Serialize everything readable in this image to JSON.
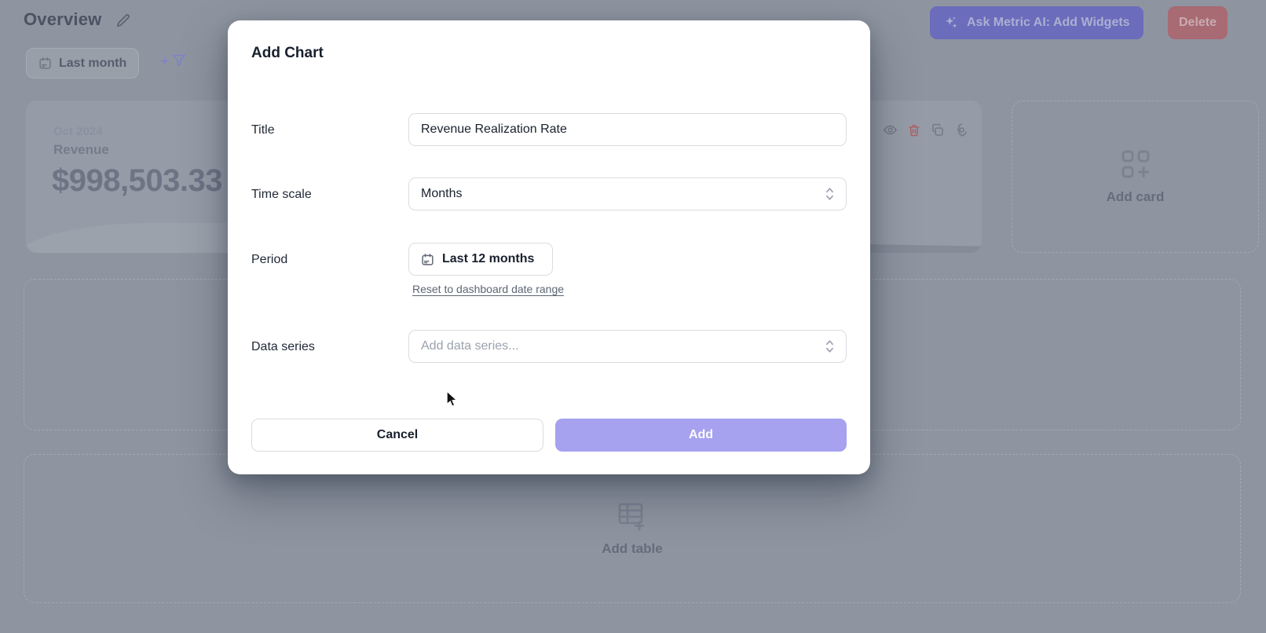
{
  "backdrop": {
    "page_title": "Overview",
    "date_filter_label": "Last month",
    "filter_plus": "+",
    "ask_ai_label": "Ask Metric AI: Add Widgets",
    "delete_label": "Delete",
    "revenue_card": {
      "period": "Oct 2024",
      "metric": "Revenue",
      "value": "$998,503.33"
    },
    "add_card_label": "Add card",
    "add_table_label": "Add table"
  },
  "modal": {
    "title": "Add Chart",
    "fields": {
      "title": {
        "label": "Title",
        "value": "Revenue Realization Rate"
      },
      "time_scale": {
        "label": "Time scale",
        "value": "Months"
      },
      "period": {
        "label": "Period",
        "value": "Last 12 months",
        "reset_link": "Reset to dashboard date range"
      },
      "data_series": {
        "label": "Data series",
        "placeholder": "Add data series..."
      }
    },
    "cancel_label": "Cancel",
    "add_label": "Add"
  },
  "colors": {
    "dimmed_page": "#8e95a0",
    "dimmed_card": "#959ca7",
    "ai_button": "#6b6cbb",
    "delete_button": "#a86a73",
    "add_button_accent": "#a6a2ef",
    "trash_icon": "#b05b60",
    "modal_text": "#18202e",
    "link": "#5d6572"
  }
}
